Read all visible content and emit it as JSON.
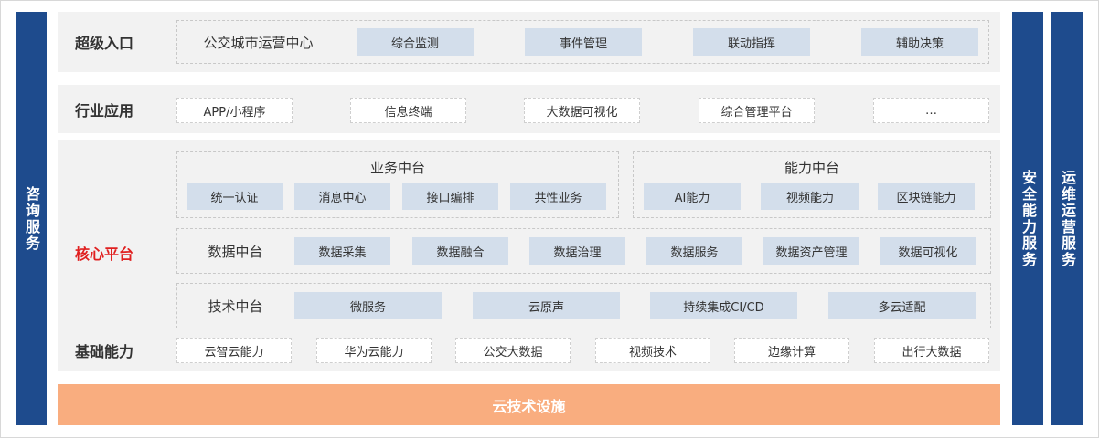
{
  "left_pill": "咨询服务",
  "right_pill_1": "安全能力服务",
  "right_pill_2": "运维运营服务",
  "row1": {
    "label": "超级入口",
    "title": "公交城市运营中心",
    "items": [
      "综合监测",
      "事件管理",
      "联动指挥",
      "辅助决策"
    ]
  },
  "row2": {
    "label": "行业应用",
    "items": [
      "APP/小程序",
      "信息终端",
      "大数据可视化",
      "综合管理平台",
      "…"
    ]
  },
  "core": {
    "label": "核心平台",
    "business": {
      "title": "业务中台",
      "items": [
        "统一认证",
        "消息中心",
        "接口编排",
        "共性业务"
      ]
    },
    "ability": {
      "title": "能力中台",
      "items": [
        "AI能力",
        "视频能力",
        "区块链能力"
      ]
    },
    "data": {
      "title": "数据中台",
      "items": [
        "数据采集",
        "数据融合",
        "数据治理",
        "数据服务",
        "数据资产管理",
        "数据可视化"
      ]
    },
    "tech": {
      "title": "技术中台",
      "items": [
        "微服务",
        "云原声",
        "持续集成CI/CD",
        "多云适配"
      ]
    }
  },
  "basic": {
    "label": "基础能力",
    "items": [
      "云智云能力",
      "华为云能力",
      "公交大数据",
      "视频技术",
      "边缘计算",
      "出行大数据"
    ]
  },
  "cloud_bar": "云技术设施"
}
